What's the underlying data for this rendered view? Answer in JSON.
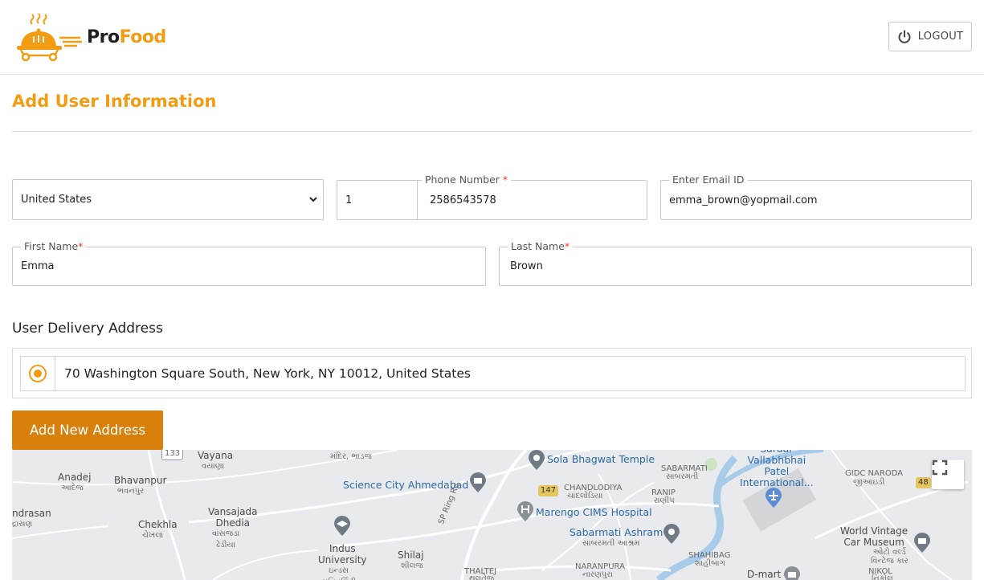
{
  "brand": {
    "name_part1": "Pro",
    "name_part2": "Food",
    "accent_color": "#f39c12"
  },
  "header": {
    "logout_label": "LOGOUT"
  },
  "page": {
    "title": "Add User Information"
  },
  "form": {
    "country": {
      "value": "United States",
      "options": [
        "United States"
      ]
    },
    "phone": {
      "label": "Phone Number",
      "required_mark": "*",
      "code": "1",
      "number": "2586543578"
    },
    "email": {
      "label": "Enter Email ID",
      "value": "emma_brown@yopmail.com"
    },
    "first_name": {
      "label": "First Name",
      "required_mark": "*",
      "value": "Emma"
    },
    "last_name": {
      "label": "Last Name",
      "required_mark": "*",
      "value": "Brown"
    }
  },
  "delivery": {
    "title": "User Delivery Address",
    "addresses": [
      {
        "text": "70 Washington Square South, New York, NY 10012, United States",
        "selected": true
      }
    ],
    "add_button_label": "Add New Address"
  },
  "map": {
    "labels": {
      "vayana": "Vayana",
      "vayana_gu": "વયાણા",
      "anadej": "Anadej",
      "anadej_gu": "આદેજ",
      "bhavanpur": "Bhavanpur",
      "bhavanpur_gu": "ભવનપુર",
      "ndrasan": "ndrasan",
      "ndrasan_gu": "દ્રાસણ",
      "chekhla": "Chekhla",
      "chekhla_gu": "ચેખલા",
      "vansajada": "Vansajada\nDhedia",
      "vansajada_gu": "વાંસજડા\nઢેડીયા",
      "indus": "Indus\nUniversity",
      "indus_gu": "ઇન્ડસ\nયુનિવર્સિટી",
      "shilaj": "Shilaj",
      "shilaj_gu": "શીલજ",
      "science_city": "Science City Ahmedabad",
      "sola_temple": "Sola Bhagwat Temple",
      "marengo": "Marengo CIMS Hospital",
      "sabarmati_ashram": "Sabarmati Ashram",
      "sabarmati_ashram_gu": "સાબરમતી આશ્રમ",
      "chandlodiya": "CHANDLODIYA",
      "chandlodiya_gu": "ચાંદલોડિયા",
      "sabarmati": "SABARMATI",
      "sabarmati_gu": "સાબરમતી",
      "ranip": "RANIP",
      "ranip_gu": "રાણીપ",
      "airport": "Sardar\nVallabhbhai\nPatel\nInternational...",
      "gidc": "GIDC NARODA",
      "gidc_gu": "જીઆઇડી",
      "world_vintage": "World Vintage\nCar Museum",
      "world_vintage_gu": "ઓટો વર્લ્ડ\nવિન્ટેજ કાર",
      "nikol": "NIKOL",
      "nikol_gu": "નિકોલ",
      "shahibag": "SHAHIBAG",
      "shahibag_gu": "શાહીબાગ",
      "naranpura": "NARANPURA",
      "naranpura_gu": "નારણપુરા",
      "thaltej": "THALTEJ",
      "thaltej_gu": "થલતેજ",
      "dmart": "D-mart",
      "sp_ring_rd": "SP Ring Rd",
      "mandir": "મંદિર, ભાડજ",
      "shield_133": "133",
      "shield_147": "147",
      "shield_48": "48"
    }
  }
}
